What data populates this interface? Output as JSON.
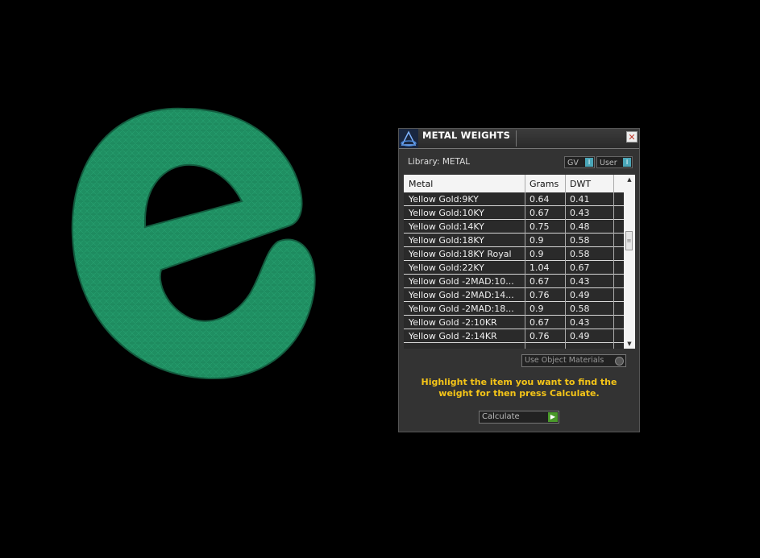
{
  "panel": {
    "title": "METAL WEIGHTS",
    "close_label": "✕",
    "library_label": "Library: METAL",
    "toggle_gv": "GV",
    "toggle_user": "User",
    "table": {
      "headers": [
        "Metal",
        "Grams",
        "DWT"
      ],
      "rows": [
        [
          "Yellow Gold:9KY",
          "0.64",
          "0.41"
        ],
        [
          "Yellow Gold:10KY",
          "0.67",
          "0.43"
        ],
        [
          "Yellow Gold:14KY",
          "0.75",
          "0.48"
        ],
        [
          "Yellow Gold:18KY",
          "0.9",
          "0.58"
        ],
        [
          "Yellow Gold:18KY Royal",
          "0.9",
          "0.58"
        ],
        [
          "Yellow Gold:22KY",
          "1.04",
          "0.67"
        ],
        [
          "Yellow Gold -2MAD:10...",
          "0.67",
          "0.43"
        ],
        [
          "Yellow Gold -2MAD:14...",
          "0.76",
          "0.49"
        ],
        [
          "Yellow Gold -2MAD:18...",
          "0.9",
          "0.58"
        ],
        [
          "Yellow Gold -2:10KR",
          "0.67",
          "0.43"
        ],
        [
          "Yellow Gold -2:14KR",
          "0.76",
          "0.49"
        ]
      ]
    },
    "use_object_materials": "Use Object Materials",
    "hint": "Highlight the item you want to find the weight for then press Calculate.",
    "calculate_label": "Calculate"
  },
  "colors": {
    "model": "#1f8f62",
    "hint": "#f5c518",
    "accent": "#4aa6b8"
  }
}
